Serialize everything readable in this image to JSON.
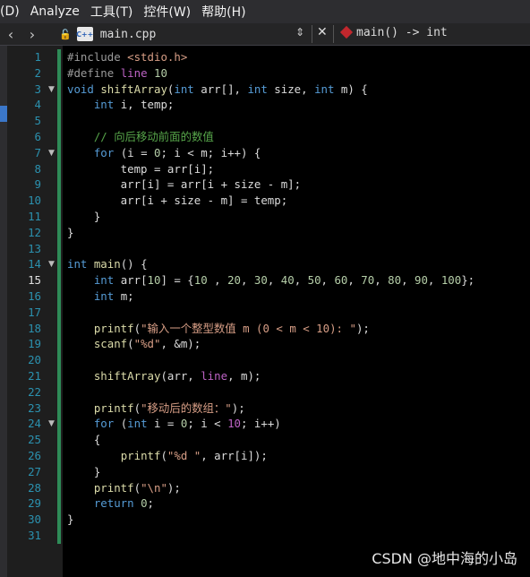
{
  "menu": {
    "items": [
      "(D)",
      "Analyze",
      "工具(T)",
      "控件(W)",
      "帮助(H)"
    ]
  },
  "tab": {
    "nav_back": "‹",
    "nav_forward": "›",
    "file_icon": "C++",
    "filename": "main.cpp",
    "function_sig": "main() -> int"
  },
  "editor": {
    "current_line": 15,
    "lines": [
      {
        "n": "1",
        "fold": "",
        "changed": true,
        "tokens": [
          [
            "pp",
            "#include "
          ],
          [
            "inc",
            "<stdio.h>"
          ]
        ]
      },
      {
        "n": "2",
        "fold": "",
        "changed": true,
        "tokens": [
          [
            "pp",
            "#define "
          ],
          [
            "mac",
            "line "
          ],
          [
            "num",
            "10"
          ]
        ]
      },
      {
        "n": "3",
        "fold": "▼",
        "changed": true,
        "tokens": [
          [
            "kw",
            "void "
          ],
          [
            "fn",
            "shiftArray"
          ],
          [
            "",
            "("
          ],
          [
            "kw",
            "int "
          ],
          [
            "",
            "arr[], "
          ],
          [
            "kw",
            "int "
          ],
          [
            "",
            "size, "
          ],
          [
            "kw",
            "int "
          ],
          [
            "",
            "m) {"
          ]
        ]
      },
      {
        "n": "4",
        "fold": "",
        "changed": true,
        "tokens": [
          [
            "",
            "    "
          ],
          [
            "kw",
            "int "
          ],
          [
            "",
            "i, temp;"
          ]
        ]
      },
      {
        "n": "5",
        "fold": "",
        "changed": true,
        "tokens": []
      },
      {
        "n": "6",
        "fold": "",
        "changed": true,
        "tokens": [
          [
            "",
            "    "
          ],
          [
            "cm",
            "// 向后移动前面的数值"
          ]
        ]
      },
      {
        "n": "7",
        "fold": "▼",
        "changed": true,
        "tokens": [
          [
            "",
            "    "
          ],
          [
            "kw",
            "for "
          ],
          [
            "",
            "(i = "
          ],
          [
            "num",
            "0"
          ],
          [
            "",
            "; i < m; i++) {"
          ]
        ]
      },
      {
        "n": "8",
        "fold": "",
        "changed": true,
        "tokens": [
          [
            "",
            "        temp = arr[i];"
          ]
        ]
      },
      {
        "n": "9",
        "fold": "",
        "changed": true,
        "tokens": [
          [
            "",
            "        arr[i] = arr[i + size - m];"
          ]
        ]
      },
      {
        "n": "10",
        "fold": "",
        "changed": true,
        "tokens": [
          [
            "",
            "        arr[i + size - m] = temp;"
          ]
        ]
      },
      {
        "n": "11",
        "fold": "",
        "changed": true,
        "tokens": [
          [
            "",
            "    }"
          ]
        ]
      },
      {
        "n": "12",
        "fold": "",
        "changed": true,
        "tokens": [
          [
            "",
            "}"
          ]
        ]
      },
      {
        "n": "13",
        "fold": "",
        "changed": true,
        "tokens": []
      },
      {
        "n": "14",
        "fold": "▼",
        "changed": true,
        "tokens": [
          [
            "kw",
            "int "
          ],
          [
            "fn",
            "main"
          ],
          [
            "",
            "() {"
          ]
        ]
      },
      {
        "n": "15",
        "fold": "",
        "changed": true,
        "tokens": [
          [
            "",
            "    "
          ],
          [
            "kw",
            "int "
          ],
          [
            "",
            "arr["
          ],
          [
            "num",
            "10"
          ],
          [
            "",
            "] = {"
          ],
          [
            "num",
            "10"
          ],
          [
            "",
            " , "
          ],
          [
            "num",
            "20"
          ],
          [
            "",
            ", "
          ],
          [
            "num",
            "30"
          ],
          [
            "",
            ", "
          ],
          [
            "num",
            "40"
          ],
          [
            "",
            ", "
          ],
          [
            "num",
            "50"
          ],
          [
            "",
            ", "
          ],
          [
            "num",
            "60"
          ],
          [
            "",
            ", "
          ],
          [
            "num",
            "70"
          ],
          [
            "",
            ", "
          ],
          [
            "num",
            "80"
          ],
          [
            "",
            ", "
          ],
          [
            "num",
            "90"
          ],
          [
            "",
            ", "
          ],
          [
            "num",
            "100"
          ],
          [
            "",
            "};"
          ]
        ]
      },
      {
        "n": "16",
        "fold": "",
        "changed": true,
        "tokens": [
          [
            "",
            "    "
          ],
          [
            "kw",
            "int "
          ],
          [
            "",
            "m;"
          ]
        ]
      },
      {
        "n": "17",
        "fold": "",
        "changed": true,
        "tokens": []
      },
      {
        "n": "18",
        "fold": "",
        "changed": true,
        "tokens": [
          [
            "",
            "    "
          ],
          [
            "fn",
            "printf"
          ],
          [
            "",
            "("
          ],
          [
            "str",
            "\"输入一个整型数值 m (0 < m < 10): \""
          ],
          [
            "",
            ");"
          ]
        ]
      },
      {
        "n": "19",
        "fold": "",
        "changed": true,
        "tokens": [
          [
            "",
            "    "
          ],
          [
            "fn",
            "scanf"
          ],
          [
            "",
            "("
          ],
          [
            "str",
            "\"%d\""
          ],
          [
            "",
            ", &m);"
          ]
        ]
      },
      {
        "n": "20",
        "fold": "",
        "changed": true,
        "tokens": []
      },
      {
        "n": "21",
        "fold": "",
        "changed": true,
        "tokens": [
          [
            "",
            "    "
          ],
          [
            "fn",
            "shiftArray"
          ],
          [
            "",
            "(arr, "
          ],
          [
            "mac",
            "line"
          ],
          [
            "",
            ", m);"
          ]
        ]
      },
      {
        "n": "22",
        "fold": "",
        "changed": true,
        "tokens": []
      },
      {
        "n": "23",
        "fold": "",
        "changed": true,
        "tokens": [
          [
            "",
            "    "
          ],
          [
            "fn",
            "printf"
          ],
          [
            "",
            "("
          ],
          [
            "str",
            "\"移动后的数组：\""
          ],
          [
            "",
            ");"
          ]
        ]
      },
      {
        "n": "24",
        "fold": "▼",
        "changed": true,
        "tokens": [
          [
            "",
            "    "
          ],
          [
            "kw",
            "for "
          ],
          [
            "",
            "("
          ],
          [
            "kw",
            "int "
          ],
          [
            "",
            "i = "
          ],
          [
            "num",
            "0"
          ],
          [
            "",
            "; i < "
          ],
          [
            "mac",
            "10"
          ],
          [
            "",
            "; i++)"
          ]
        ]
      },
      {
        "n": "25",
        "fold": "",
        "changed": true,
        "tokens": [
          [
            "",
            "    {"
          ]
        ]
      },
      {
        "n": "26",
        "fold": "",
        "changed": true,
        "tokens": [
          [
            "",
            "        "
          ],
          [
            "fn",
            "printf"
          ],
          [
            "",
            "("
          ],
          [
            "str",
            "\"%d \""
          ],
          [
            "",
            ", arr[i]);"
          ]
        ]
      },
      {
        "n": "27",
        "fold": "",
        "changed": true,
        "tokens": [
          [
            "",
            "    }"
          ]
        ]
      },
      {
        "n": "28",
        "fold": "",
        "changed": true,
        "tokens": [
          [
            "",
            "    "
          ],
          [
            "fn",
            "printf"
          ],
          [
            "",
            "("
          ],
          [
            "str",
            "\"\\n\""
          ],
          [
            "",
            ");"
          ]
        ]
      },
      {
        "n": "29",
        "fold": "",
        "changed": true,
        "tokens": [
          [
            "",
            "    "
          ],
          [
            "kw",
            "return "
          ],
          [
            "num",
            "0"
          ],
          [
            "",
            ";"
          ]
        ]
      },
      {
        "n": "30",
        "fold": "",
        "changed": true,
        "tokens": [
          [
            "",
            "}"
          ]
        ]
      },
      {
        "n": "31",
        "fold": "",
        "changed": true,
        "tokens": []
      }
    ]
  },
  "watermark": "CSDN @地中海的小岛"
}
